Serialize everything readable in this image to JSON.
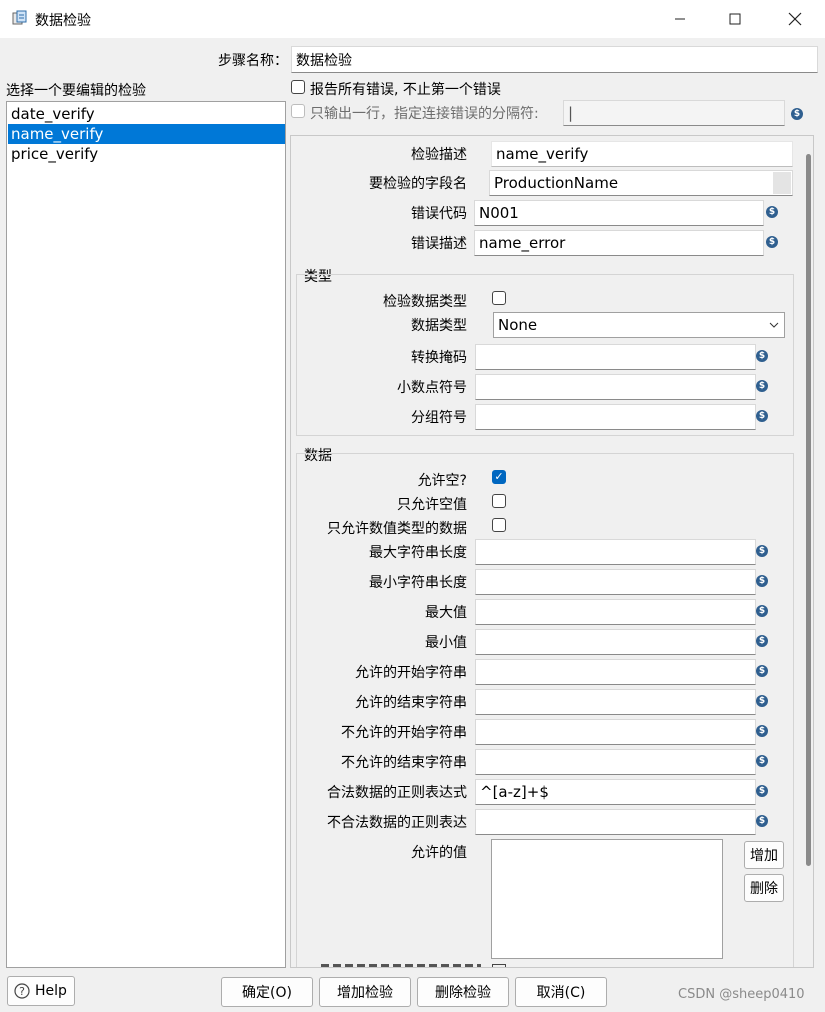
{
  "window": {
    "title": "数据检验",
    "minimize_icon": "minimize-icon",
    "maximize_icon": "maximize-icon",
    "close_icon": "close-icon"
  },
  "step_name": {
    "label": "步骤名称：",
    "value": "数据检验"
  },
  "validations_list": {
    "label": "选择一个要编辑的检验",
    "items": [
      "date_verify",
      "name_verify",
      "price_verify"
    ],
    "selected": "name_verify"
  },
  "options": {
    "report_all_errors": "报告所有错误, 不止第一个错误",
    "single_row_label": "只输出一行，指定连接错误的分隔符:",
    "single_row_value": "|"
  },
  "details": {
    "description_label": "检验描述",
    "description_value": "name_verify",
    "field_label": "要检验的字段名",
    "field_value": "ProductionName",
    "error_code_label": "错误代码",
    "error_code_value": "N001",
    "error_desc_label": "错误描述",
    "error_desc_value": "name_error"
  },
  "type_group": {
    "title": "类型",
    "check_type_label": "检验数据类型",
    "data_type_label": "数据类型",
    "data_type_value": "None",
    "conversion_mask_label": "转换掩码",
    "decimal_symbol_label": "小数点符号",
    "grouping_symbol_label": "分组符号"
  },
  "data_group": {
    "title": "数据",
    "allow_null_label": "允许空?",
    "allow_null_checked": true,
    "only_null_label": "只允许空值",
    "only_numeric_label": "只允许数值类型的数据",
    "max_length_label": "最大字符串长度",
    "min_length_label": "最小字符串长度",
    "max_value_label": "最大值",
    "min_value_label": "最小值",
    "start_string_label": "允许的开始字符串",
    "end_string_label": "允许的结束字符串",
    "not_start_label": "不允许的开始字符串",
    "not_end_label": "不允许的结束字符串",
    "regex_label": "合法数据的正则表达式",
    "regex_value": "^[a-z]+$",
    "not_regex_label": "不合法数据的正则表达",
    "allowed_values_label": "允许的值",
    "add_button": "增加",
    "delete_button": "删除"
  },
  "footer": {
    "help": "Help",
    "ok": "确定(O)",
    "add_validation": "增加检验",
    "delete_validation": "删除检验",
    "cancel": "取消(C)",
    "watermark": "CSDN @sheep0410"
  },
  "colors": {
    "selection": "#0078d7",
    "checkbox_checked": "#0067c0",
    "variable_icon": "#2f5f8f"
  }
}
